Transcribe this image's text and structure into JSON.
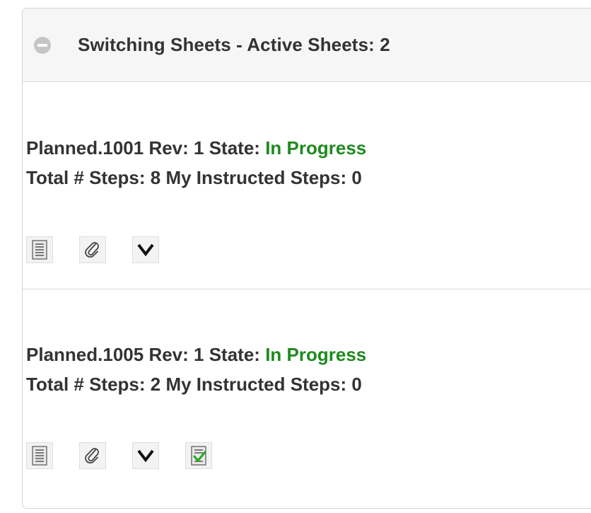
{
  "panel": {
    "title": "Switching Sheets - Active Sheets: 2"
  },
  "sheets": [
    {
      "id_label": "Planned.1001",
      "rev_label": "Rev: 1",
      "state_prefix": "State:",
      "state": "In Progress",
      "total_steps_label": "Total # Steps: 8",
      "instructed_label": "My Instructed Steps: 0",
      "actions": [
        "list-icon",
        "paperclip-icon",
        "chevron-down-icon"
      ]
    },
    {
      "id_label": "Planned.1005",
      "rev_label": "Rev: 1",
      "state_prefix": "State:",
      "state": "In Progress",
      "total_steps_label": "Total # Steps: 2",
      "instructed_label": "My Instructed Steps: 0",
      "actions": [
        "list-icon",
        "paperclip-icon",
        "chevron-down-icon",
        "checklist-icon"
      ]
    }
  ],
  "colors": {
    "state_in_progress": "#1f8a1f",
    "header_bg": "#f6f6f6",
    "text": "#333333"
  }
}
